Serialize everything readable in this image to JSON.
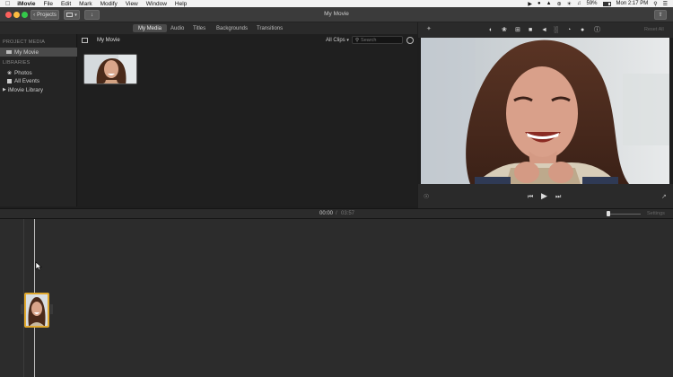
{
  "menubar": {
    "apple": "",
    "app_name": "iMovie",
    "items": [
      "File",
      "Edit",
      "Mark",
      "Modify",
      "View",
      "Window",
      "Help"
    ],
    "battery": "59%",
    "clock": "Mon 2:17 PM"
  },
  "window": {
    "title": "My Movie",
    "projects_button": "Projects"
  },
  "tabs": [
    "My Media",
    "Audio",
    "Titles",
    "Backgrounds",
    "Transitions"
  ],
  "sidebar": {
    "project_media_header": "PROJECT MEDIA",
    "project_item": "My Movie",
    "libraries_header": "LIBRARIES",
    "items": [
      "Photos",
      "All Events",
      "iMovie Library"
    ]
  },
  "browser": {
    "title": "My Movie",
    "filter": "All Clips",
    "search_placeholder": "Search"
  },
  "viewer": {
    "reset_all": "Reset All"
  },
  "timeline": {
    "current_time": "00:00",
    "separator": "/",
    "total_time": "03:57",
    "settings_label": "Settings"
  },
  "colors": {
    "accent": "#e0a82e",
    "selection": "#4a4a4a",
    "background": "#1e1e1e"
  }
}
